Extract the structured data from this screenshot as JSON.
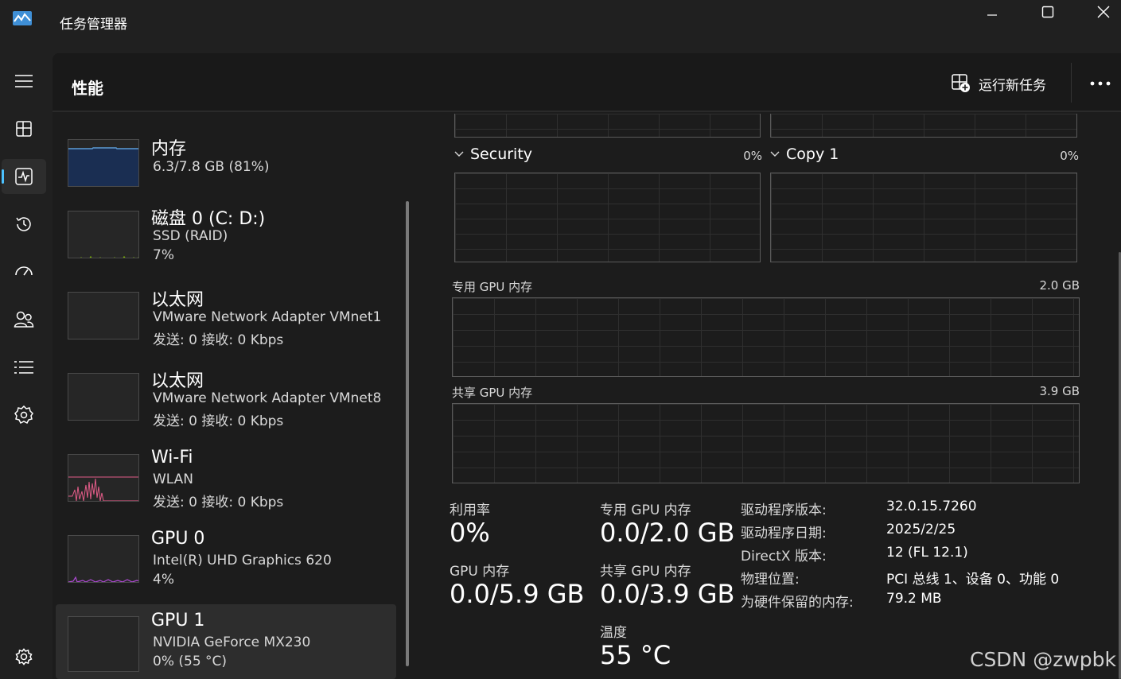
{
  "window": {
    "title": "任务管理器",
    "accent": "#4cc2ff"
  },
  "rail": {
    "items": [
      {
        "icon": "hamburger-menu-icon"
      },
      {
        "icon": "processes-icon"
      },
      {
        "icon": "performance-icon",
        "active": true
      },
      {
        "icon": "app-history-icon"
      },
      {
        "icon": "startup-apps-icon"
      },
      {
        "icon": "users-icon"
      },
      {
        "icon": "details-icon"
      },
      {
        "icon": "services-icon"
      },
      {
        "icon": "settings-icon"
      }
    ]
  },
  "header": {
    "title": "性能",
    "run_task_label": "运行新任务",
    "more_icon": "more-icon"
  },
  "devices": [
    {
      "name": "内存",
      "line1": "6.3/7.8 GB (81%)",
      "line2": "",
      "graph_color": "#5b9bd5"
    },
    {
      "name": "磁盘 0 (C: D:)",
      "line1": "SSD (RAID)",
      "line2": "7%",
      "graph_color": "#7fba00"
    },
    {
      "name": "以太网",
      "line1": "VMware Network Adapter VMnet1",
      "line2": "发送: 0 接收: 0 Kbps",
      "graph_color": "#c27cb0"
    },
    {
      "name": "以太网",
      "line1": "VMware Network Adapter VMnet8",
      "line2": "发送: 0 接收: 0 Kbps",
      "graph_color": "#c27cb0"
    },
    {
      "name": "Wi-Fi",
      "line1": "WLAN",
      "line2": "发送: 0 接收: 0 Kbps",
      "graph_color": "#e25c88"
    },
    {
      "name": "GPU 0",
      "line1": "Intel(R) UHD Graphics 620",
      "line2": "4%",
      "graph_color": "#b04ad6"
    },
    {
      "name": "GPU 1",
      "line1": "NVIDIA GeForce MX230",
      "line2": "0%  (55 °C)",
      "graph_color": "#b04ad6",
      "selected": true
    }
  ],
  "detail": {
    "engines": [
      {
        "name": "Security",
        "pct": "0%"
      },
      {
        "name": "Copy 1",
        "pct": "0%"
      }
    ],
    "dedicated_mem": {
      "label": "专用 GPU 内存",
      "max": "2.0 GB"
    },
    "shared_mem": {
      "label": "共享 GPU 内存",
      "max": "3.9 GB"
    },
    "stats": {
      "utilization": {
        "label": "利用率",
        "value": "0%"
      },
      "dedicated": {
        "label": "专用 GPU 内存",
        "value": "0.0/2.0 GB"
      },
      "gpu_mem": {
        "label": "GPU 内存",
        "value": "0.0/5.9 GB"
      },
      "shared": {
        "label": "共享 GPU 内存",
        "value": "0.0/3.9 GB"
      },
      "temp": {
        "label": "温度",
        "value": "55 °C"
      }
    },
    "info": [
      {
        "key": "驱动程序版本:",
        "value": "32.0.15.7260"
      },
      {
        "key": "驱动程序日期:",
        "value": "2025/2/25"
      },
      {
        "key": "DirectX 版本:",
        "value": "12 (FL 12.1)"
      },
      {
        "key": "物理位置:",
        "value": "PCI 总线 1、设备 0、功能 0"
      },
      {
        "key": "为硬件保留的内存:",
        "value": "79.2 MB"
      }
    ]
  },
  "watermark": "CSDN @zwpbk"
}
